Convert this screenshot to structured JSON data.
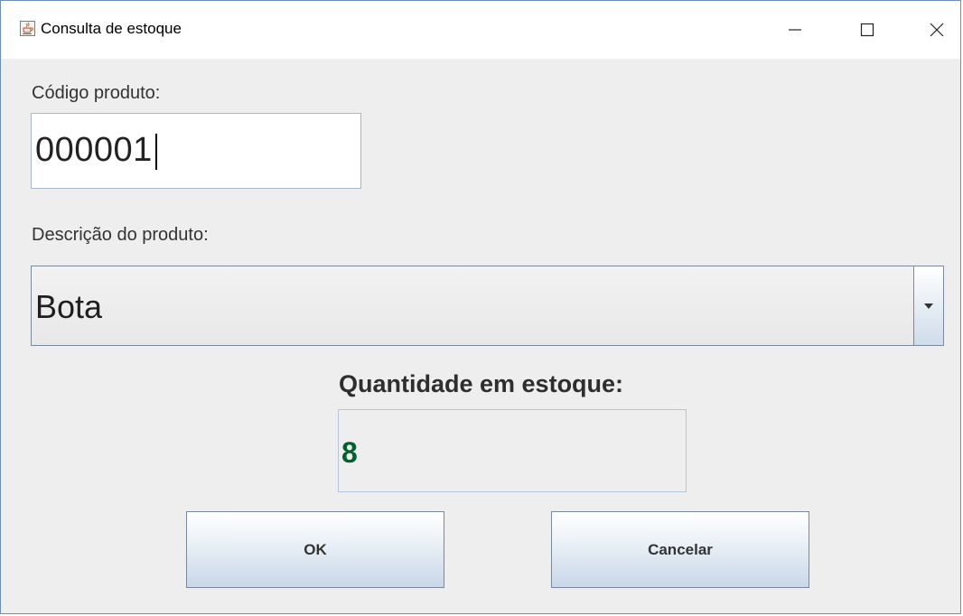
{
  "window": {
    "title": "Consulta de estoque"
  },
  "form": {
    "code_label": "Código produto:",
    "code_value": "000001",
    "description_label": "Descrição do produto:",
    "description_value": "Bota",
    "quantity_label": "Quantidade em estoque:",
    "quantity_value": "8"
  },
  "buttons": {
    "ok_label": "OK",
    "cancel_label": "Cancelar"
  },
  "colors": {
    "quantity_text": "#006030",
    "window_border": "#6b8fb8",
    "background": "#eeeeee"
  },
  "icons": {
    "app": "java-cup-icon",
    "minimize": "minimize-icon",
    "maximize": "maximize-icon",
    "close": "close-icon",
    "dropdown": "dropdown-arrow-icon"
  }
}
